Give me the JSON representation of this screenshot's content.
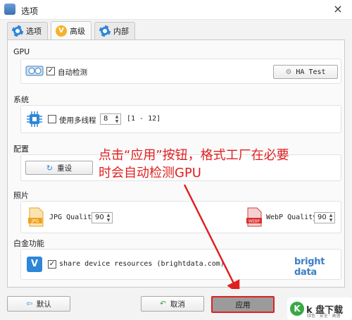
{
  "window": {
    "title": "选项",
    "close_glyph": "×"
  },
  "tabs": [
    {
      "label": "选项",
      "icon": "gear-icon"
    },
    {
      "label": "高级",
      "icon": "v-badge-icon",
      "active": true
    },
    {
      "label": "内部",
      "icon": "gear-icon"
    }
  ],
  "gpu": {
    "section_title": "GPU",
    "auto_detect_label": "自动检测",
    "auto_detect_checked": true,
    "test_button_label": "HA Test"
  },
  "system": {
    "section_title": "系统",
    "multithread_label": "使用多线程",
    "multithread_checked": false,
    "thread_count": "8",
    "range_label": "[1 - 12]"
  },
  "config": {
    "section_title": "配置",
    "reset_label": "重设"
  },
  "photo": {
    "section_title": "照片",
    "jpg_label": "JPG Quality",
    "jpg_value": "90",
    "jpg_icon_text": "JPG",
    "webp_label": "WebP Quality",
    "webp_value": "90",
    "webp_icon_text": "WEBP"
  },
  "platinum": {
    "section_title": "白金功能",
    "share_label": "share device resources (brightdata.com)",
    "share_checked": true,
    "logo_text": "bright data"
  },
  "annotation": {
    "line1": "点击“应用”按钮，格式工厂在必要",
    "line2": "时会自动检测GPU",
    "color": "#e02020"
  },
  "footer": {
    "default_label": "默认",
    "cancel_label": "取消",
    "apply_label": "应用"
  },
  "watermark": {
    "glyph": "K",
    "text": "k 盘下载",
    "sub": "绿色 · 安全 · 高速"
  },
  "colors": {
    "accent_blue": "#2d86d8",
    "highlight_red": "#e02020",
    "apply_bg": "#9b9b9b"
  }
}
